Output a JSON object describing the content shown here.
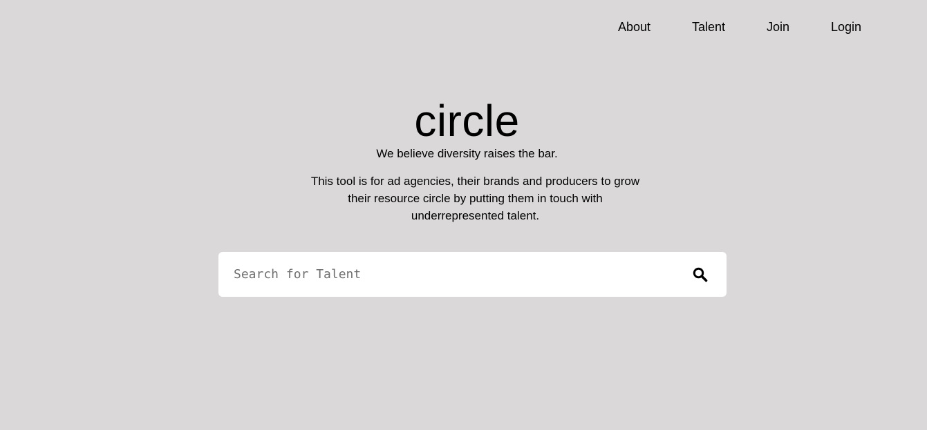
{
  "nav": {
    "items": [
      {
        "label": "About"
      },
      {
        "label": "Talent"
      },
      {
        "label": "Join"
      },
      {
        "label": "Login"
      }
    ]
  },
  "hero": {
    "title": "circle",
    "tagline": "We believe diversity raises the bar.",
    "description": "This tool is for ad agencies, their brands and producers to grow their resource circle by putting them in touch with underrepresented talent."
  },
  "search": {
    "placeholder": "Search for Talent",
    "value": "",
    "icon": "search-icon"
  },
  "colors": {
    "background": "#dad8d9",
    "search_box": "#ffffff",
    "text": "#000000",
    "placeholder": "#6f6f6f"
  }
}
